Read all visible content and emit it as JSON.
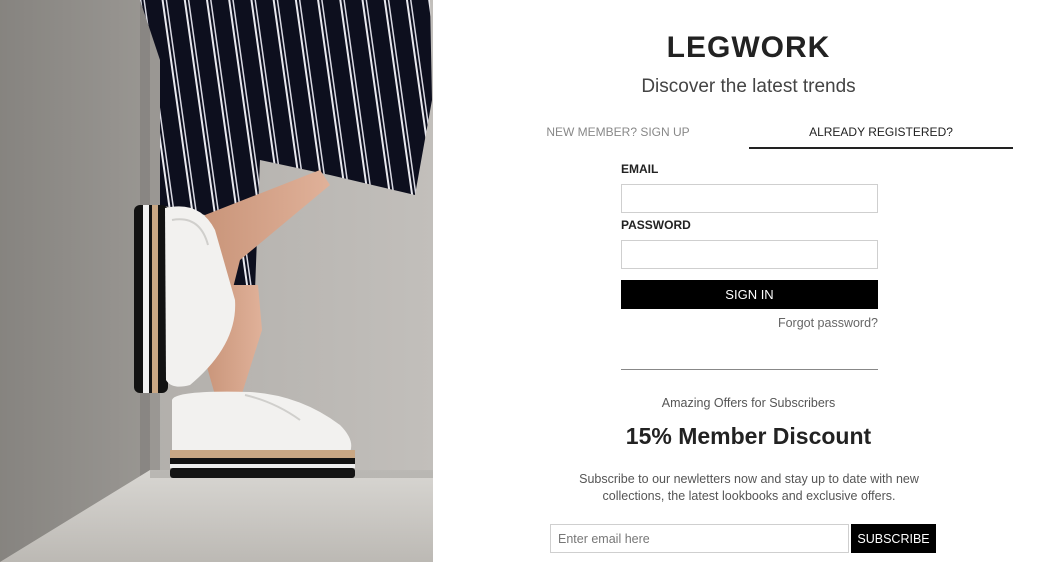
{
  "brand": {
    "title": "LEGWORK",
    "tagline": "Discover the latest trends"
  },
  "tabs": [
    {
      "label": "NEW MEMBER? SIGN UP",
      "active": false
    },
    {
      "label": "ALREADY REGISTERED?",
      "active": true
    }
  ],
  "login": {
    "email_label": "EMAIL",
    "email_value": "",
    "password_label": "PASSWORD",
    "password_value": "",
    "submit_label": "SIGN IN",
    "forgot_label": "Forgot password?"
  },
  "newsletter": {
    "kicker": "Amazing Offers for Subscribers",
    "headline": "15% Member Discount",
    "description": "Subscribe to our newletters now and stay up to date with new collections, the latest lookbooks and exclusive offers.",
    "email_placeholder": "Enter email here",
    "button_label": "SUBSCRIBE"
  },
  "hero_image": {
    "subject": "woman-in-striped-culottes-white-platform-brogues"
  },
  "colors": {
    "accent": "#000000",
    "text": "#222222",
    "muted": "#888888"
  }
}
